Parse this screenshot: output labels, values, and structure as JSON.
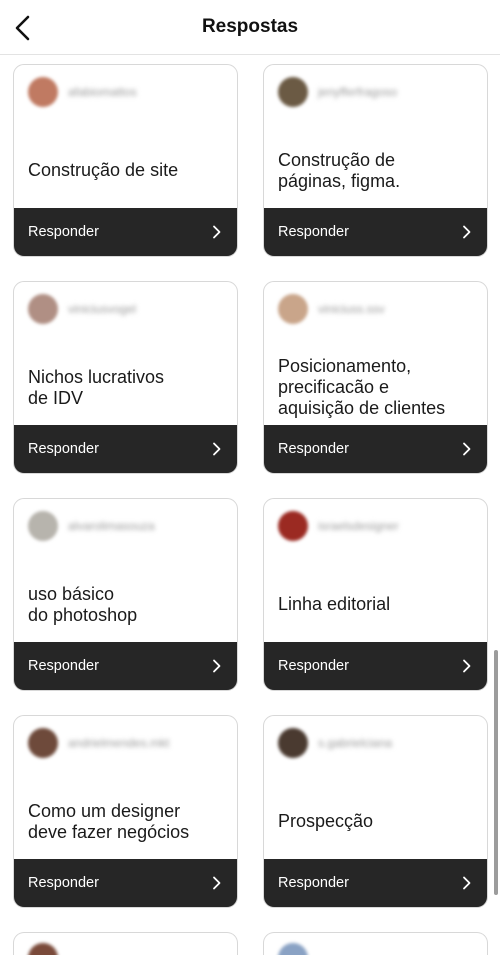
{
  "header": {
    "title": "Respostas"
  },
  "respond_label": "Responder",
  "cards": [
    {
      "username": "afabiomattos",
      "question": "Construção de site",
      "avatar_color": "#c07a62"
    },
    {
      "username": "jenyfferfragoso",
      "question": "Construção de\npáginas, figma.",
      "avatar_color": "#6b5a44"
    },
    {
      "username": "viniciusvogel",
      "question": "Nichos lucrativos\nde IDV",
      "avatar_color": "#b08f84"
    },
    {
      "username": "viniciuss.ssv",
      "question": "Posicionamento,\nprecificacão e\naquisição de clientes",
      "avatar_color": "#c9a58a"
    },
    {
      "username": "alvarolimasouza",
      "question": "uso básico\ndo photoshop",
      "avatar_color": "#b7b4ad"
    },
    {
      "username": "israelsdesigner",
      "question": "Linha editorial",
      "avatar_color": "#9b2a22"
    },
    {
      "username": "andrielmendes.mkt",
      "question": "Como um designer\ndeve fazer negócios",
      "avatar_color": "#6e4a3b"
    },
    {
      "username": "s.gabrielciana",
      "question": "Prospecção",
      "avatar_color": "#4a3a30"
    }
  ],
  "partial_cards": [
    {
      "avatar_color": "#7a4a3a"
    },
    {
      "avatar_color": "#8aa2c4"
    }
  ]
}
